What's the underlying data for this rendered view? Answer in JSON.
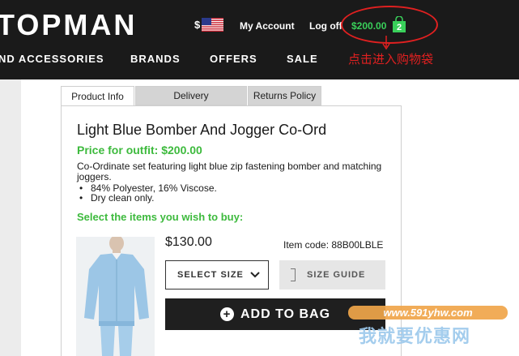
{
  "header": {
    "logo": "TOPMAN",
    "currency_symbol": "$",
    "flag_icon": "us-flag-icon",
    "my_account": "My Account",
    "log_out": "Log off",
    "bag_total": "$200.00",
    "bag_count": "2",
    "bag_color": "#39d05a",
    "annotation": "点击进入购物袋",
    "annotation_color": "#e02020"
  },
  "nav": {
    "items": [
      "ND ACCESSORIES",
      "BRANDS",
      "OFFERS",
      "SALE"
    ]
  },
  "tabs": [
    {
      "label": "Product Info",
      "active": true
    },
    {
      "label": "Delivery",
      "active": false
    },
    {
      "label": "Returns Policy",
      "active": false
    }
  ],
  "product": {
    "title": "Light Blue Bomber And Jogger Co-Ord",
    "outfit_price": "Price for outfit: $200.00",
    "description": "Co-Ordinate set featuring light blue zip fastening bomber and matching joggers.",
    "details": [
      "84% Polyester, 16% Viscose.",
      "Dry clean only."
    ],
    "select_prompt": "Select the items you wish to buy:",
    "accent_color": "#3dba3d"
  },
  "item": {
    "price": "$130.00",
    "code": "Item code: 88B00LBLE",
    "select_size": "SELECT SIZE",
    "size_guide": "SIZE GUIDE",
    "add_to_bag": "ADD TO BAG"
  },
  "watermark": {
    "site": "www.591yhw.com",
    "name": "我就要优惠网"
  }
}
